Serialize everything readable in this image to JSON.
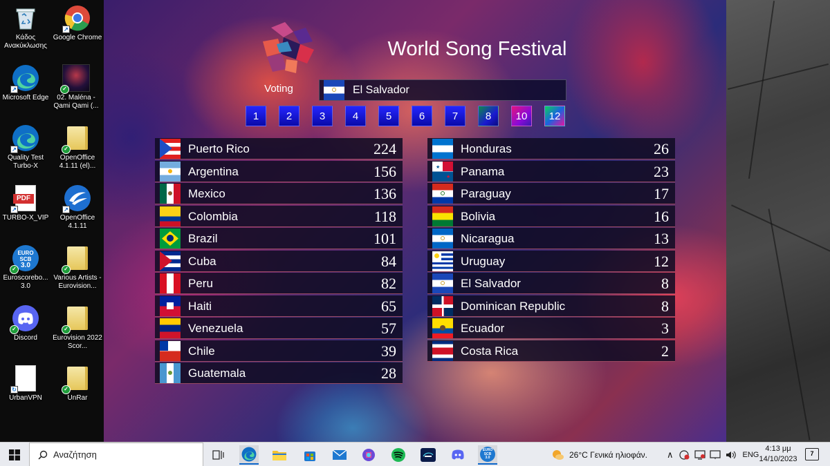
{
  "desktop": {
    "icons": [
      {
        "label": "Κάδος Ανακύκλωσης",
        "icon": "recycle-bin-icon"
      },
      {
        "label": "Google Chrome",
        "icon": "chrome-icon"
      },
      {
        "label": "Microsoft Edge",
        "icon": "edge-icon"
      },
      {
        "label": "02. Maléna - Qami Qami (...",
        "icon": "video-thumbnail-icon"
      },
      {
        "label": "Quality Test Turbo-X",
        "icon": "edge-icon"
      },
      {
        "label": "OpenOffice 4.1.11 (el)...",
        "icon": "folder-icon"
      },
      {
        "label": "TURBO-X_VIP",
        "icon": "pdf-icon"
      },
      {
        "label": "OpenOffice 4.1.11",
        "icon": "openoffice-icon"
      },
      {
        "label": "Euroscorebo... 3.0",
        "icon": "euroscoreboard-icon"
      },
      {
        "label": "Various Artists - Eurovision...",
        "icon": "folder-icon"
      },
      {
        "label": "Discord",
        "icon": "discord-icon"
      },
      {
        "label": "Eurovision 2022 Scor...",
        "icon": "folder-icon"
      },
      {
        "label": "UrbanVPN",
        "icon": "document-icon"
      },
      {
        "label": "UnRar",
        "icon": "folder-icon"
      }
    ],
    "euroscore_icon_text": [
      "EURO",
      "SCB",
      "3.0"
    ]
  },
  "app": {
    "title": "World Song Festival",
    "voting_label": "Voting",
    "current_voter": "El Salvador",
    "round_tabs": [
      "1",
      "2",
      "3",
      "4",
      "5",
      "6",
      "7",
      "8",
      "10",
      "12"
    ]
  },
  "scoreboard": {
    "left": [
      {
        "country": "Puerto Rico",
        "points": "224"
      },
      {
        "country": "Argentina",
        "points": "156"
      },
      {
        "country": "Mexico",
        "points": "136"
      },
      {
        "country": "Colombia",
        "points": "118"
      },
      {
        "country": "Brazil",
        "points": "101"
      },
      {
        "country": "Cuba",
        "points": "84"
      },
      {
        "country": "Peru",
        "points": "82"
      },
      {
        "country": "Haiti",
        "points": "65"
      },
      {
        "country": "Venezuela",
        "points": "57"
      },
      {
        "country": "Chile",
        "points": "39"
      },
      {
        "country": "Guatemala",
        "points": "28"
      }
    ],
    "right": [
      {
        "country": "Honduras",
        "points": "26"
      },
      {
        "country": "Panama",
        "points": "23"
      },
      {
        "country": "Paraguay",
        "points": "17"
      },
      {
        "country": "Bolivia",
        "points": "16"
      },
      {
        "country": "Nicaragua",
        "points": "13"
      },
      {
        "country": "Uruguay",
        "points": "12"
      },
      {
        "country": "El Salvador",
        "points": "8"
      },
      {
        "country": "Dominican Republic",
        "points": "8"
      },
      {
        "country": "Ecuador",
        "points": "3"
      },
      {
        "country": "Costa Rica",
        "points": "2"
      }
    ]
  },
  "taskbar": {
    "search_placeholder": "Αναζήτηση",
    "weather": "26°C  Γενικά ηλιοφάν.",
    "language": "ENG",
    "time": "4:13 μμ",
    "date": "14/10/2023",
    "notification_count": "7",
    "euroscore_icon_text": [
      "EURO",
      "SCB",
      "3.0"
    ]
  }
}
